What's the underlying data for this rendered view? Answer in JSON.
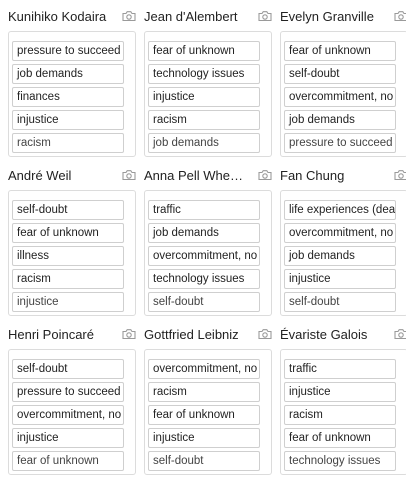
{
  "cards": [
    {
      "name": "Kunihiko Kodaira",
      "items": [
        "pressure to succeed",
        "job demands",
        "finances",
        "injustice",
        "racism"
      ]
    },
    {
      "name": "Jean d'Alembert",
      "items": [
        "fear of unknown",
        "technology issues",
        "injustice",
        "racism",
        "job demands"
      ]
    },
    {
      "name": "Evelyn Granville",
      "items": [
        "fear of unknown",
        "self-doubt",
        "overcommitment, no",
        "job demands",
        "pressure to succeed"
      ]
    },
    {
      "name": "André Weil",
      "items": [
        "self-doubt",
        "fear of unknown",
        "illness",
        "racism",
        "injustice"
      ]
    },
    {
      "name": "Anna Pell Whe…",
      "items": [
        "traffic",
        "job demands",
        "overcommitment, no",
        "technology issues",
        "self-doubt"
      ]
    },
    {
      "name": "Fan Chung",
      "items": [
        "life experiences (dea",
        "overcommitment, no",
        "job demands",
        "injustice",
        "self-doubt"
      ]
    },
    {
      "name": "Henri Poincaré",
      "items": [
        "self-doubt",
        "pressure to succeed",
        "overcommitment, no",
        "injustice",
        "fear of unknown"
      ]
    },
    {
      "name": "Gottfried Leibniz",
      "items": [
        "overcommitment, no",
        "racism",
        "fear of unknown",
        "injustice",
        "self-doubt"
      ]
    },
    {
      "name": "Évariste Galois",
      "items": [
        "traffic",
        "injustice",
        "racism",
        "fear of unknown",
        "technology issues"
      ]
    }
  ]
}
